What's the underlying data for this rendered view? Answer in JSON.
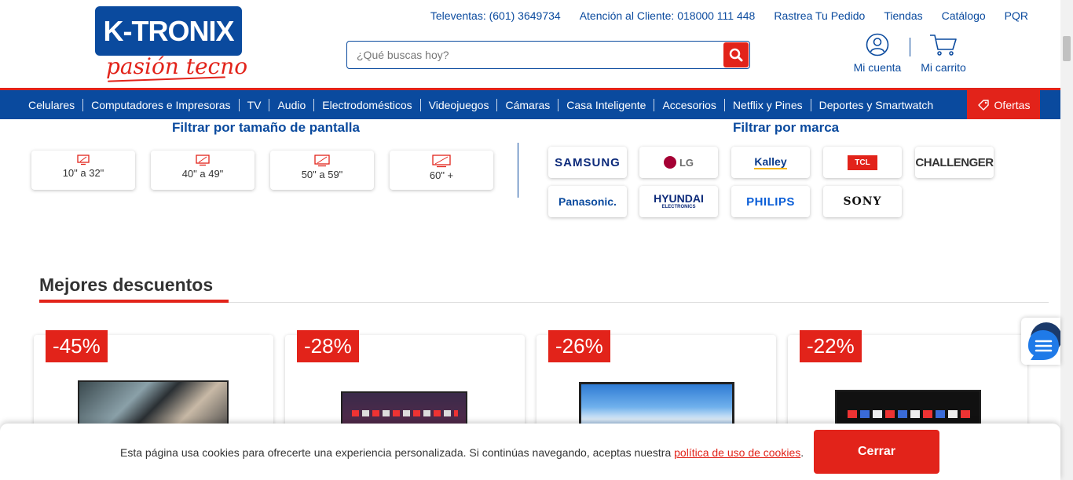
{
  "brand": {
    "logo_text": "K-TRONIX",
    "tagline": "pasión tecno",
    "primary_color": "#0a4a9e",
    "accent_color": "#e2231a"
  },
  "header": {
    "links": [
      "Televentas: (601) 3649734",
      "Atención al Cliente: 018000 111 448",
      "Rastrea Tu Pedido",
      "Tiendas",
      "Catálogo",
      "PQR"
    ],
    "search_placeholder": "¿Qué buscas hoy?",
    "account_label": "Mi cuenta",
    "cart_label": "Mi carrito"
  },
  "nav": {
    "items": [
      "Celulares",
      "Computadores e Impresoras",
      "TV",
      "Audio",
      "Electrodomésticos",
      "Videojuegos",
      "Cámaras",
      "Casa Inteligente",
      "Accesorios",
      "Netflix y Pines",
      "Deportes y Smartwatch"
    ],
    "offers_label": "Ofertas"
  },
  "filters": {
    "size_title": "Filtrar por tamaño de pantalla",
    "sizes": [
      "10\" a 32\"",
      "40\" a 49\"",
      "50\" a 59\"",
      "60\" +"
    ],
    "brand_title": "Filtrar por marca",
    "brands": [
      "SAMSUNG",
      "LG",
      "Kalley",
      "TCL",
      "CHALLENGER",
      "Panasonic.",
      "HYUNDAI",
      "PHILIPS",
      "SONY"
    ],
    "hyundai_sub": "ELECTRONICS"
  },
  "discounts": {
    "title": "Mejores descuentos",
    "badges": [
      "-45%",
      "-28%",
      "-26%",
      "-22%"
    ]
  },
  "cookies": {
    "text": "Esta página usa cookies para ofrecerte una experiencia personalizada. Si continúas navegando, aceptas nuestra ",
    "link": "política de uso de cookies",
    "period": ".",
    "button": "Cerrar"
  }
}
